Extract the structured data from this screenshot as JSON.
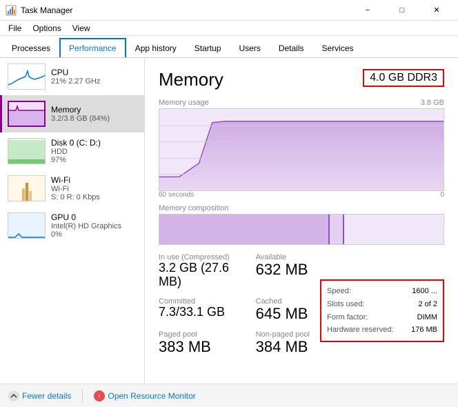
{
  "titlebar": {
    "title": "Task Manager",
    "minimize": "−",
    "maximize": "□",
    "close": "✕"
  },
  "menubar": {
    "items": [
      "File",
      "Options",
      "View"
    ]
  },
  "tabs": [
    {
      "label": "Processes",
      "active": false
    },
    {
      "label": "Performance",
      "active": true
    },
    {
      "label": "App history",
      "active": false
    },
    {
      "label": "Startup",
      "active": false
    },
    {
      "label": "Users",
      "active": false
    },
    {
      "label": "Details",
      "active": false
    },
    {
      "label": "Services",
      "active": false
    }
  ],
  "sidebar": {
    "items": [
      {
        "id": "cpu",
        "name": "CPU",
        "stats": "21% 2.27 GHz",
        "active": false
      },
      {
        "id": "memory",
        "name": "Memory",
        "stats": "3.2/3.8 GB (84%)",
        "active": true
      },
      {
        "id": "disk",
        "name": "Disk 0 (C: D:)",
        "stats": "HDD\n97%",
        "stats1": "HDD",
        "stats2": "97%",
        "active": false
      },
      {
        "id": "wifi",
        "name": "Wi-Fi",
        "stats1": "Wi-Fi",
        "stats2": "S: 0  R: 0 Kbps",
        "active": false
      },
      {
        "id": "gpu",
        "name": "GPU 0",
        "stats1": "Intel(R) HD Graphics",
        "stats2": "0%",
        "active": false
      }
    ]
  },
  "panel": {
    "title": "Memory",
    "spec": "4.0 GB DDR3",
    "chart_label": "Memory usage",
    "chart_max": "3.8 GB",
    "time_left": "60 seconds",
    "time_right": "0",
    "comp_label": "Memory composition",
    "stats": {
      "in_use_label": "In use (Compressed)",
      "in_use_value": "3.2 GB (27.6 MB)",
      "available_label": "Available",
      "available_value": "632 MB",
      "committed_label": "Committed",
      "committed_value": "7.3/33.1 GB",
      "cached_label": "Cached",
      "cached_value": "645 MB",
      "paged_label": "Paged pool",
      "paged_value": "383 MB",
      "nonpaged_label": "Non-paged pool",
      "nonpaged_value": "384 MB"
    },
    "info": {
      "speed_label": "Speed:",
      "speed_value": "1600 ...",
      "slots_label": "Slots used:",
      "slots_value": "2 of 2",
      "form_label": "Form factor:",
      "form_value": "DIMM",
      "hw_label": "Hardware reserved:",
      "hw_value": "176 MB"
    }
  },
  "bottombar": {
    "fewer_label": "Fewer details",
    "monitor_label": "Open Resource Monitor"
  }
}
